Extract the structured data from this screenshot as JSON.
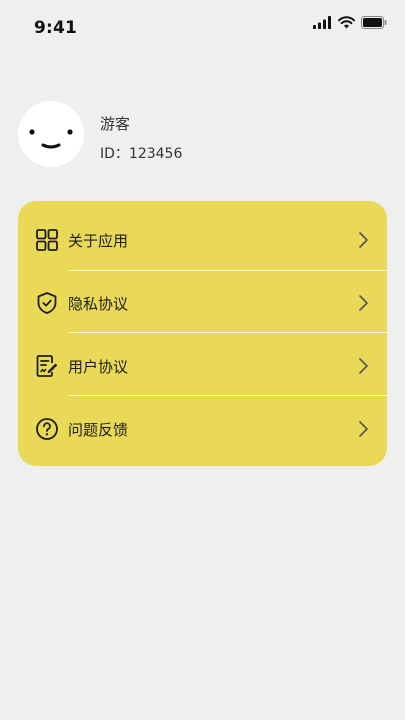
{
  "status_bar": {
    "time": "9:41",
    "icons": [
      "signal-icon",
      "wifi-icon",
      "battery-icon"
    ]
  },
  "profile": {
    "avatar_icon": "smiley-face-icon",
    "name": "游客",
    "id_text": "ID：123456"
  },
  "menu": {
    "background_color": "#e9d957",
    "items": [
      {
        "label": "关于应用",
        "icon": "grid-apps-icon"
      },
      {
        "label": "隐私协议",
        "icon": "shield-check-icon"
      },
      {
        "label": "用户协议",
        "icon": "document-edit-icon"
      },
      {
        "label": "问题反馈",
        "icon": "question-circle-icon"
      }
    ]
  }
}
